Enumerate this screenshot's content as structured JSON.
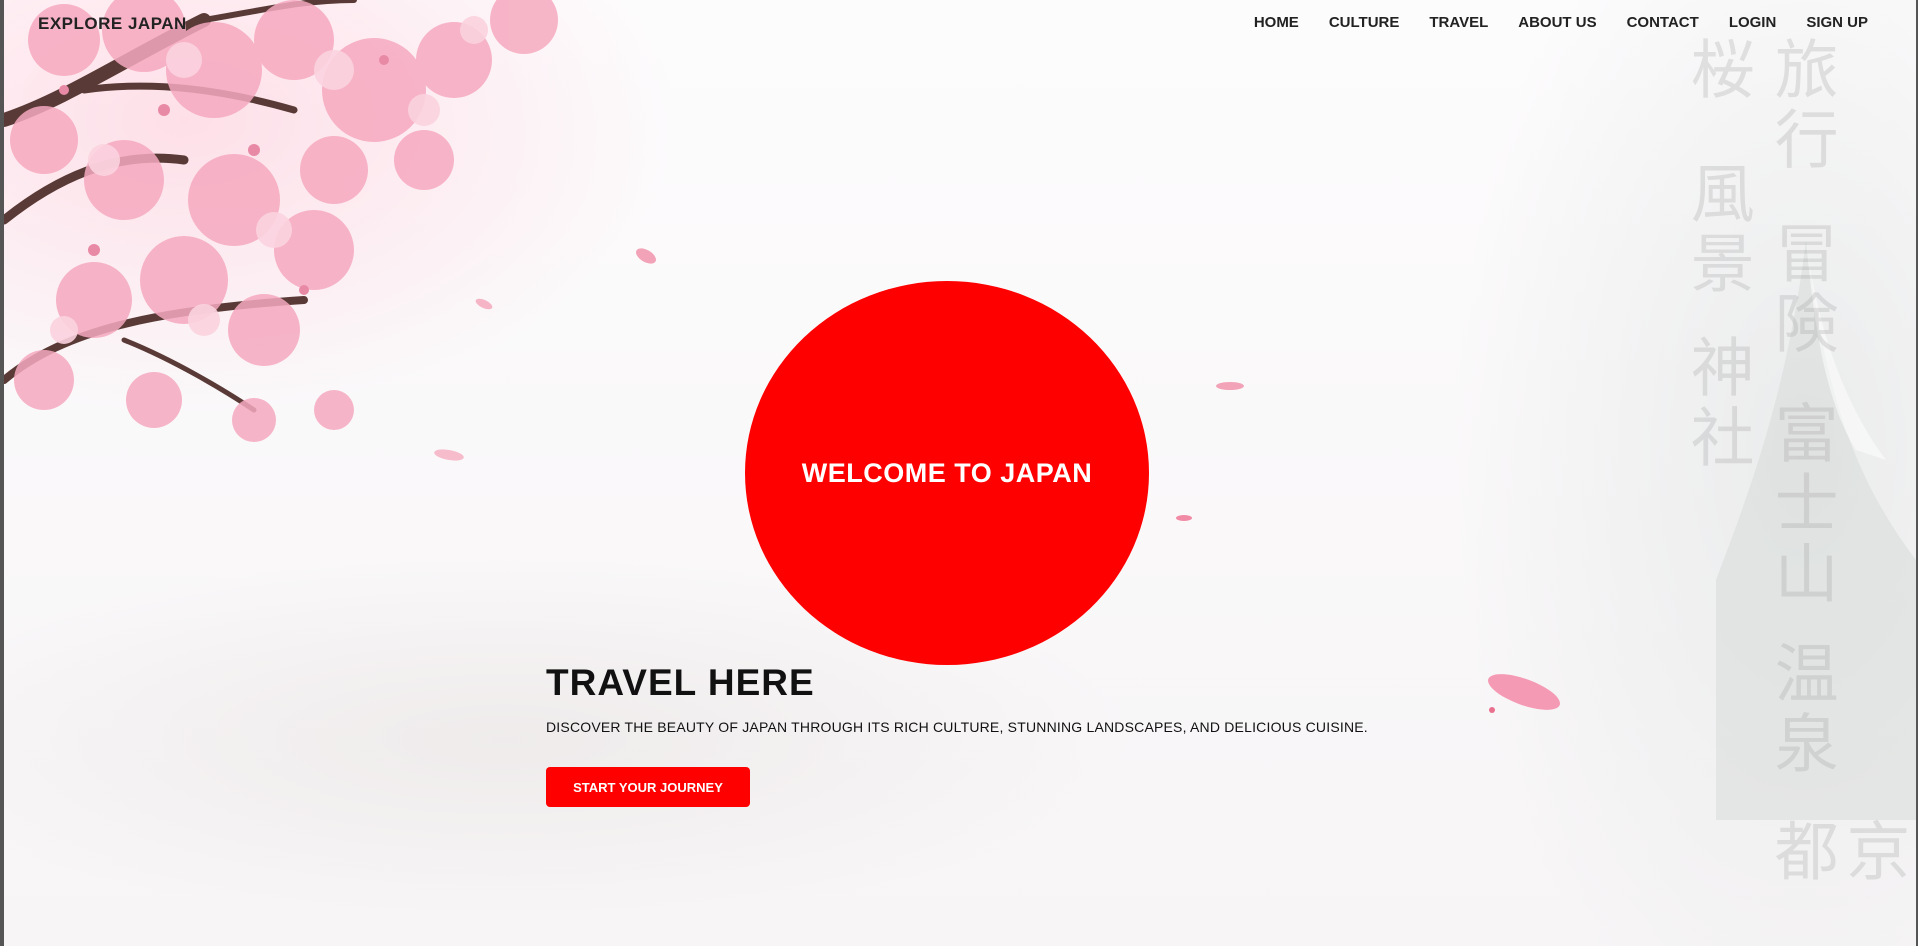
{
  "header": {
    "brand": "Explore Japan",
    "nav": [
      {
        "label": "Home"
      },
      {
        "label": "Culture"
      },
      {
        "label": "Travel"
      },
      {
        "label": "About Us"
      },
      {
        "label": "Contact"
      },
      {
        "label": "Login"
      },
      {
        "label": "Sign Up"
      }
    ]
  },
  "hero": {
    "circle_text": "Welcome to Japan",
    "title": "Travel Here",
    "description": "Discover the beauty of Japan through its rich culture, stunning landscapes, and delicious cuisine.",
    "cta_label": "Start Your Journey"
  },
  "background_kanji": {
    "column_left": [
      "桜",
      "風景",
      "神社"
    ],
    "column_right": [
      "旅行",
      "冒険",
      "富士山",
      "温泉",
      "京都"
    ]
  },
  "colors": {
    "accent": "#ff0000",
    "text": "#111111",
    "blossom": "#f4a7bd",
    "kanji": "#8c8c8c"
  },
  "icons": {
    "decor_left": "cherry-blossom-branch",
    "decor_right": "mountain-silhouette",
    "decor_petals": "falling-petals"
  }
}
